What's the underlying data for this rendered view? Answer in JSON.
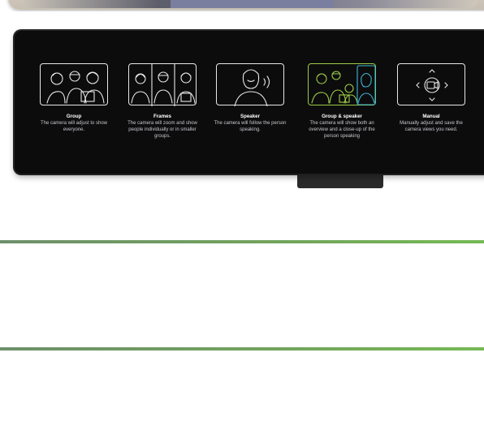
{
  "modes": [
    {
      "title": "Group",
      "desc": "The camera will adjust to show everyone.",
      "icon": "group-icon"
    },
    {
      "title": "Frames",
      "desc": "The camera will zoom and show people individually or in smaller groups.",
      "icon": "frames-icon"
    },
    {
      "title": "Speaker",
      "desc": "The camera will follow the person speaking.",
      "icon": "speaker-icon"
    },
    {
      "title": "Group & speaker",
      "desc": "The camera will show both an overview and a close-up of the person speaking",
      "icon": "group-and-speaker-icon",
      "selected": true
    },
    {
      "title": "Manual",
      "desc": "Manually adjust and save the camera views you need.",
      "icon": "manual-icon"
    }
  ],
  "colors": {
    "panel_bg": "#0c0c0d",
    "selected_border": "#9ccc46",
    "selected_border_alt": "#3fb6d8",
    "divider": "#72a55c"
  }
}
